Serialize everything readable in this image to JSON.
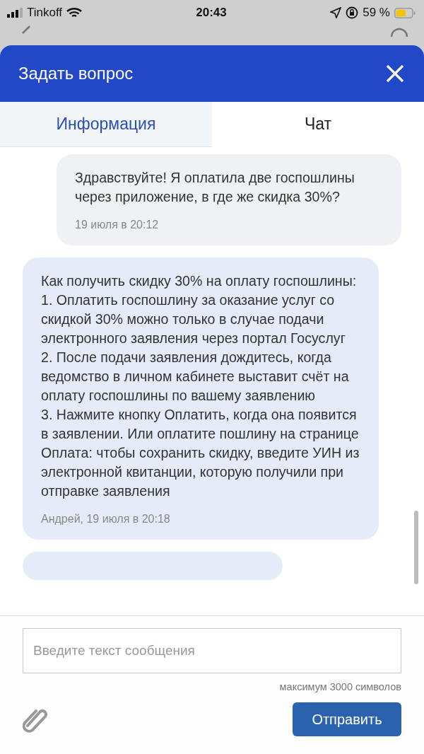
{
  "status_bar": {
    "carrier": "Tinkoff",
    "time": "20:43",
    "battery": "59 %"
  },
  "modal": {
    "title": "Задать вопрос"
  },
  "tabs": [
    {
      "label": "Информация",
      "selected": false
    },
    {
      "label": "Чат",
      "selected": true
    }
  ],
  "messages": [
    {
      "kind": "user",
      "text": "Здравствуйте! Я оплатила две госпошлины через приложение, в где же скидка 30%?",
      "meta": "19 июля в 20:12"
    },
    {
      "kind": "agent",
      "text": "Как получить скидку 30% на оплату госпошлины:\n1. Оплатить госпошлину за оказание услуг со скидкой 30% можно только в случае подачи электронного заявления через портал Госуслуг\n2. После подачи заявления дождитесь, когда ведомство в личном кабинете выставит счёт на оплату госпошлины по вашему заявлению\n3. Нажмите кнопку Оплатить, когда она появится в заявлении. Или оплатите пошлину на странице Оплата: чтобы сохранить скидку, введите УИН из электронной квитанции, которую получили при отправке заявления",
      "meta": "Андрей, 19 июля в 20:18"
    },
    {
      "kind": "partial"
    }
  ],
  "composer": {
    "placeholder": "Введите текст сообщения",
    "hint": "максимум 3000 символов",
    "send_button": "Отправить"
  }
}
